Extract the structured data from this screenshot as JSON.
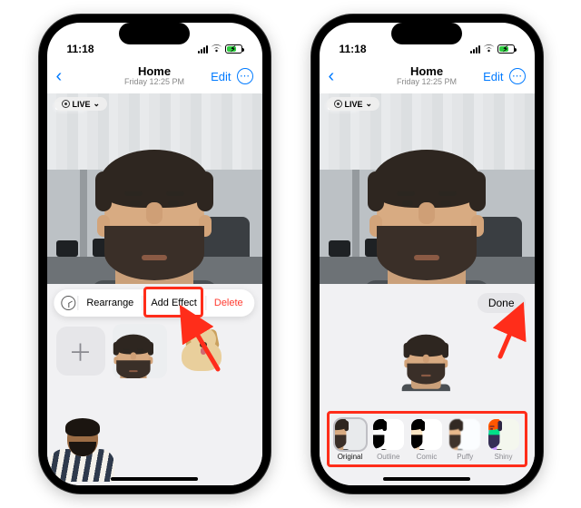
{
  "status": {
    "time": "11:18"
  },
  "nav": {
    "title": "Home",
    "subtitle": "Friday 12:25 PM",
    "edit": "Edit"
  },
  "live_badge": "LIVE",
  "phone1": {
    "actions": {
      "rearrange": "Rearrange",
      "add_effect": "Add Effect",
      "delete": "Delete"
    }
  },
  "phone2": {
    "done": "Done",
    "effects": [
      {
        "id": "original",
        "label": "Original",
        "selected": true
      },
      {
        "id": "outline",
        "label": "Outline",
        "selected": false
      },
      {
        "id": "comic",
        "label": "Comic",
        "selected": false
      },
      {
        "id": "puffy",
        "label": "Puffy",
        "selected": false
      },
      {
        "id": "shiny",
        "label": "Shiny",
        "selected": false
      }
    ]
  },
  "colors": {
    "accent": "#007aff",
    "destructive": "#ff3b30",
    "callout": "#ff2d1a"
  }
}
